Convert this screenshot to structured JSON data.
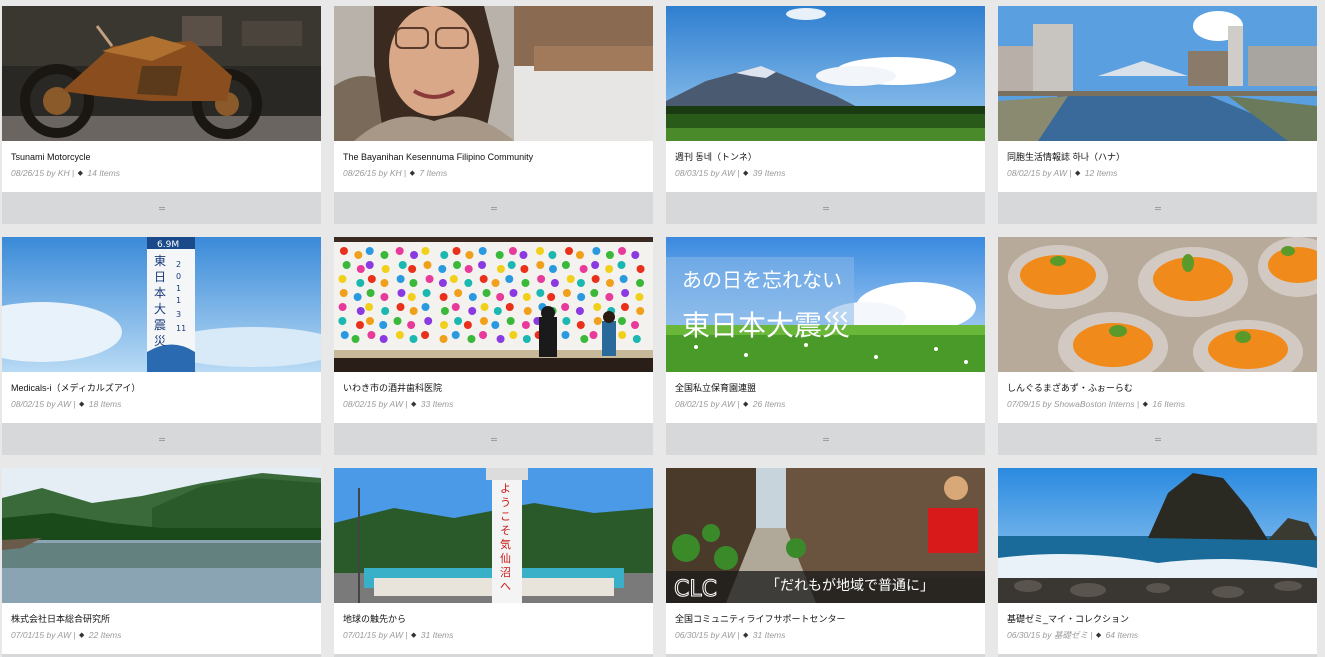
{
  "collections": [
    {
      "title": "Tsunami Motorcycle",
      "date": "08/26/15",
      "by": "by",
      "author": "KH",
      "items": "14 Items",
      "theme": "moto"
    },
    {
      "title": "The Bayanihan Kesennuma Filipino Community",
      "date": "08/26/15",
      "by": "by",
      "author": "KH",
      "items": "7 Items",
      "theme": "portrait"
    },
    {
      "title": "週刊 동네（トンネ）",
      "date": "08/03/15",
      "by": "by",
      "author": "AW",
      "items": "39 Items",
      "theme": "mountain"
    },
    {
      "title": "同胞生活情報誌 하나（ハナ）",
      "date": "08/02/15",
      "by": "by",
      "author": "AW",
      "items": "12 Items",
      "theme": "river"
    },
    {
      "title": "Medicals-i（メディカルズアイ）",
      "date": "08/02/15",
      "by": "by",
      "author": "AW",
      "items": "18 Items",
      "theme": "sign"
    },
    {
      "title": "いわき市の酒井歯科医院",
      "date": "08/02/15",
      "by": "by",
      "author": "AW",
      "items": "33 Items",
      "theme": "hands"
    },
    {
      "title": "全国私立保育園連盟",
      "date": "08/02/15",
      "by": "by",
      "author": "AW",
      "items": "26 Items",
      "theme": "field"
    },
    {
      "title": "しんぐるまざあず・ふぉーらむ",
      "date": "07/09/15",
      "by": "by",
      "author": "ShowaBoston Interns",
      "items": "16 Items",
      "theme": "oranges"
    },
    {
      "title": "株式会社日本総合研究所",
      "date": "07/01/15",
      "by": "by",
      "author": "AW",
      "items": "22 Items",
      "theme": "lake"
    },
    {
      "title": "地球の触先から",
      "date": "07/01/15",
      "by": "by",
      "author": "AW",
      "items": "31 Items",
      "theme": "tower"
    },
    {
      "title": "全国コミュニティライフサポートセンター",
      "date": "06/30/15",
      "by": "by",
      "author": "AW",
      "items": "31 Items",
      "theme": "alley"
    },
    {
      "title": "基礎ゼミ_マイ・コレクション",
      "date": "06/30/15",
      "by": "by",
      "author": "基礎ゼミ",
      "items": "64 Items",
      "theme": "coast"
    }
  ],
  "thumb_text": {
    "sign": "6.9M 東日本大震災 2011.3.11",
    "field_line1": "あの日を忘れない",
    "field_line2": "東日本大震災",
    "tower": "ようこそ気仙沼へ",
    "alley_brand": "CLC",
    "alley_slogan": "「だれもが地域で普通に」"
  },
  "colors": {
    "background": "#e8e8e8",
    "card": "#ffffff",
    "footer": "#d6d8da",
    "meta": "#9a9a9a"
  },
  "icons": {
    "items": "stack-icon",
    "footer": "drag-handle-icon"
  }
}
